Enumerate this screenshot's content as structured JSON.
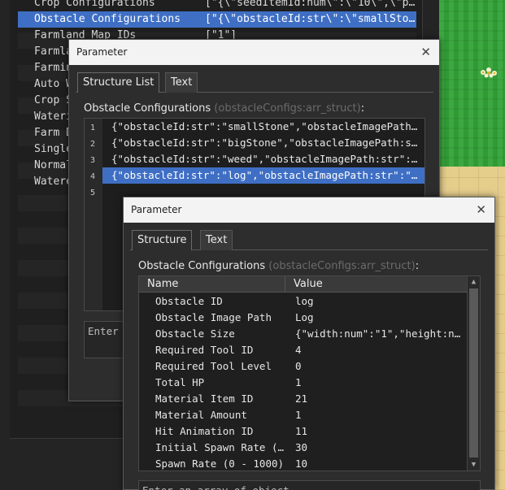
{
  "colors": {
    "selection": "#3f6fc4",
    "panel": "#2d2d2d",
    "grass": "#33a338",
    "sand": "#e5cd8c"
  },
  "db_rows": [
    {
      "key": "Crop Configurations",
      "value": "[\"{\\\"seedItemId:num\\\":\\\"10\\\",\\\"p…"
    },
    {
      "key": "Obstacle Configurations",
      "value": "[\"{\\\"obstacleId:str\\\":\\\"smallSto…"
    },
    {
      "key": "Farmland Map IDs",
      "value": "[\"1\"]"
    },
    {
      "key": "Farmla",
      "value": ""
    },
    {
      "key": "Farmin",
      "value": ""
    },
    {
      "key": "Auto W",
      "value": ""
    },
    {
      "key": "Crop S",
      "value": ""
    },
    {
      "key": "Wateri",
      "value": ""
    },
    {
      "key": "Farm D",
      "value": ""
    },
    {
      "key": "Single",
      "value": ""
    },
    {
      "key": "Normal",
      "value": ""
    },
    {
      "key": "Watere",
      "value": ""
    }
  ],
  "dialog1": {
    "title": "Parameter",
    "close_glyph": "✕",
    "tabs": [
      "Structure List",
      "Text"
    ],
    "heading": "Obstacle Configurations",
    "heading_id": "(obstacleConfigs:arr_struct)",
    "heading_suffix": ":",
    "lines": [
      "{\"obstacleId:str\":\"smallStone\",\"obstacleImagePath:str\":…",
      "{\"obstacleId:str\":\"bigStone\",\"obstacleImagePath:str\":…",
      "{\"obstacleId:str\":\"weed\",\"obstacleImagePath:str\":\"we…",
      "{\"obstacleId:str\":\"log\",\"obstacleImagePath:str\":\"Log…",
      ""
    ],
    "line_numbers": [
      "1",
      "2",
      "3",
      "4",
      "5"
    ],
    "input_placeholder": "Enter a"
  },
  "dialog2": {
    "title": "Parameter",
    "close_glyph": "✕",
    "tabs": [
      "Structure",
      "Text"
    ],
    "heading": "Obstacle Configurations",
    "heading_id": "(obstacleConfigs:arr_struct)",
    "heading_suffix": ":",
    "columns": [
      "Name",
      "Value"
    ],
    "rows": [
      {
        "name": "Obstacle ID",
        "value": "log"
      },
      {
        "name": "Obstacle Image Path",
        "value": "Log"
      },
      {
        "name": "Obstacle Size",
        "value": "{\"width:num\":\"1\",\"height:nu…"
      },
      {
        "name": "Required Tool ID",
        "value": "4"
      },
      {
        "name": "Required Tool Level",
        "value": "0"
      },
      {
        "name": "Total HP",
        "value": "1"
      },
      {
        "name": "Material Item ID",
        "value": "21"
      },
      {
        "name": "Material Amount",
        "value": "1"
      },
      {
        "name": "Hit Animation ID",
        "value": "11"
      },
      {
        "name": "Initial Spawn Rate (…",
        "value": "30"
      },
      {
        "name": "Spawn Rate (0 - 1000)",
        "value": "10"
      }
    ],
    "input_placeholder": "Enter an array of object"
  }
}
